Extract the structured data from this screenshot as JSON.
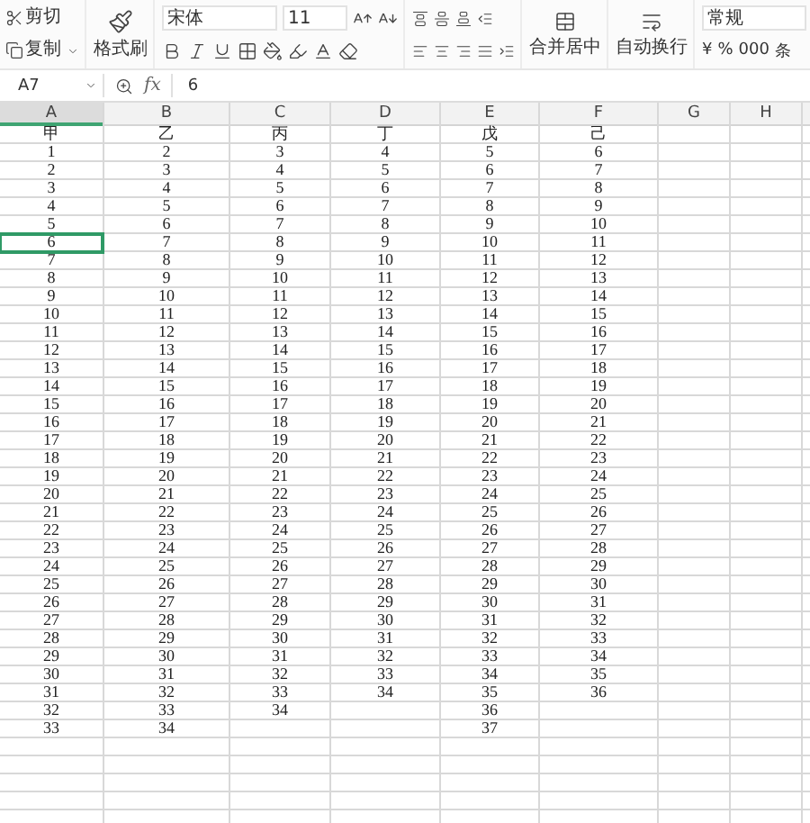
{
  "toolbar": {
    "cut": "剪切",
    "copy": "复制",
    "format_painter": "格式刷",
    "font_name": "宋体",
    "font_size": "11",
    "merge": "合并居中",
    "wrap": "自动换行",
    "number_format": "常规",
    "number_buttons": [
      "¥",
      "%",
      "000"
    ],
    "cut_off_label": "条"
  },
  "formula_bar": {
    "cell_ref": "A7",
    "fx": "fx",
    "value": "6"
  },
  "sheet": {
    "columns": [
      {
        "header": "A",
        "selected": true,
        "cells": [
          {
            "value": "甲",
            "selected": false
          },
          {
            "value": "1",
            "selected": false
          },
          {
            "value": "2",
            "selected": false
          },
          {
            "value": "3",
            "selected": false
          },
          {
            "value": "4",
            "selected": false
          },
          {
            "value": "5",
            "selected": false
          },
          {
            "value": "6",
            "selected": true
          },
          {
            "value": "7",
            "selected": false
          },
          {
            "value": "8",
            "selected": false
          },
          {
            "value": "9",
            "selected": false
          },
          {
            "value": "10",
            "selected": false
          },
          {
            "value": "11",
            "selected": false
          },
          {
            "value": "12",
            "selected": false
          },
          {
            "value": "13",
            "selected": false
          },
          {
            "value": "14",
            "selected": false
          },
          {
            "value": "15",
            "selected": false
          },
          {
            "value": "16",
            "selected": false
          },
          {
            "value": "17",
            "selected": false
          },
          {
            "value": "18",
            "selected": false
          },
          {
            "value": "19",
            "selected": false
          },
          {
            "value": "20",
            "selected": false
          },
          {
            "value": "21",
            "selected": false
          },
          {
            "value": "22",
            "selected": false
          },
          {
            "value": "23",
            "selected": false
          },
          {
            "value": "24",
            "selected": false
          },
          {
            "value": "25",
            "selected": false
          },
          {
            "value": "26",
            "selected": false
          },
          {
            "value": "27",
            "selected": false
          },
          {
            "value": "28",
            "selected": false
          },
          {
            "value": "29",
            "selected": false
          },
          {
            "value": "30",
            "selected": false
          },
          {
            "value": "31",
            "selected": false
          },
          {
            "value": "32",
            "selected": false
          },
          {
            "value": "33",
            "selected": false
          }
        ]
      },
      {
        "header": "B",
        "selected": false,
        "cells": [
          {
            "value": "乙",
            "selected": false
          },
          {
            "value": "2",
            "selected": false
          },
          {
            "value": "3",
            "selected": false
          },
          {
            "value": "4",
            "selected": false
          },
          {
            "value": "5",
            "selected": false
          },
          {
            "value": "6",
            "selected": false
          },
          {
            "value": "7",
            "selected": false
          },
          {
            "value": "8",
            "selected": false
          },
          {
            "value": "9",
            "selected": false
          },
          {
            "value": "10",
            "selected": false
          },
          {
            "value": "11",
            "selected": false
          },
          {
            "value": "12",
            "selected": false
          },
          {
            "value": "13",
            "selected": false
          },
          {
            "value": "14",
            "selected": false
          },
          {
            "value": "15",
            "selected": false
          },
          {
            "value": "16",
            "selected": false
          },
          {
            "value": "17",
            "selected": false
          },
          {
            "value": "18",
            "selected": false
          },
          {
            "value": "19",
            "selected": false
          },
          {
            "value": "20",
            "selected": false
          },
          {
            "value": "21",
            "selected": false
          },
          {
            "value": "22",
            "selected": false
          },
          {
            "value": "23",
            "selected": false
          },
          {
            "value": "24",
            "selected": false
          },
          {
            "value": "25",
            "selected": false
          },
          {
            "value": "26",
            "selected": false
          },
          {
            "value": "27",
            "selected": false
          },
          {
            "value": "28",
            "selected": false
          },
          {
            "value": "29",
            "selected": false
          },
          {
            "value": "30",
            "selected": false
          },
          {
            "value": "31",
            "selected": false
          },
          {
            "value": "32",
            "selected": false
          },
          {
            "value": "33",
            "selected": false
          },
          {
            "value": "34",
            "selected": false
          }
        ]
      },
      {
        "header": "C",
        "selected": false,
        "cells": [
          {
            "value": "丙",
            "selected": false
          },
          {
            "value": "3",
            "selected": false
          },
          {
            "value": "4",
            "selected": false
          },
          {
            "value": "5",
            "selected": false
          },
          {
            "value": "6",
            "selected": false
          },
          {
            "value": "7",
            "selected": false
          },
          {
            "value": "8",
            "selected": false
          },
          {
            "value": "9",
            "selected": false
          },
          {
            "value": "10",
            "selected": false
          },
          {
            "value": "11",
            "selected": false
          },
          {
            "value": "12",
            "selected": false
          },
          {
            "value": "13",
            "selected": false
          },
          {
            "value": "14",
            "selected": false
          },
          {
            "value": "15",
            "selected": false
          },
          {
            "value": "16",
            "selected": false
          },
          {
            "value": "17",
            "selected": false
          },
          {
            "value": "18",
            "selected": false
          },
          {
            "value": "19",
            "selected": false
          },
          {
            "value": "20",
            "selected": false
          },
          {
            "value": "21",
            "selected": false
          },
          {
            "value": "22",
            "selected": false
          },
          {
            "value": "23",
            "selected": false
          },
          {
            "value": "24",
            "selected": false
          },
          {
            "value": "25",
            "selected": false
          },
          {
            "value": "26",
            "selected": false
          },
          {
            "value": "27",
            "selected": false
          },
          {
            "value": "28",
            "selected": false
          },
          {
            "value": "29",
            "selected": false
          },
          {
            "value": "30",
            "selected": false
          },
          {
            "value": "31",
            "selected": false
          },
          {
            "value": "32",
            "selected": false
          },
          {
            "value": "33",
            "selected": false
          },
          {
            "value": "34",
            "selected": false
          }
        ]
      },
      {
        "header": "D",
        "selected": false,
        "cells": [
          {
            "value": "丁",
            "selected": false
          },
          {
            "value": "4",
            "selected": false
          },
          {
            "value": "5",
            "selected": false
          },
          {
            "value": "6",
            "selected": false
          },
          {
            "value": "7",
            "selected": false
          },
          {
            "value": "8",
            "selected": false
          },
          {
            "value": "9",
            "selected": false
          },
          {
            "value": "10",
            "selected": false
          },
          {
            "value": "11",
            "selected": false
          },
          {
            "value": "12",
            "selected": false
          },
          {
            "value": "13",
            "selected": false
          },
          {
            "value": "14",
            "selected": false
          },
          {
            "value": "15",
            "selected": false
          },
          {
            "value": "16",
            "selected": false
          },
          {
            "value": "17",
            "selected": false
          },
          {
            "value": "18",
            "selected": false
          },
          {
            "value": "19",
            "selected": false
          },
          {
            "value": "20",
            "selected": false
          },
          {
            "value": "21",
            "selected": false
          },
          {
            "value": "22",
            "selected": false
          },
          {
            "value": "23",
            "selected": false
          },
          {
            "value": "24",
            "selected": false
          },
          {
            "value": "25",
            "selected": false
          },
          {
            "value": "26",
            "selected": false
          },
          {
            "value": "27",
            "selected": false
          },
          {
            "value": "28",
            "selected": false
          },
          {
            "value": "29",
            "selected": false
          },
          {
            "value": "30",
            "selected": false
          },
          {
            "value": "31",
            "selected": false
          },
          {
            "value": "32",
            "selected": false
          },
          {
            "value": "33",
            "selected": false
          },
          {
            "value": "34",
            "selected": false
          }
        ]
      },
      {
        "header": "E",
        "selected": false,
        "cells": [
          {
            "value": "戊",
            "selected": false
          },
          {
            "value": "5",
            "selected": false
          },
          {
            "value": "6",
            "selected": false
          },
          {
            "value": "7",
            "selected": false
          },
          {
            "value": "8",
            "selected": false
          },
          {
            "value": "9",
            "selected": false
          },
          {
            "value": "10",
            "selected": false
          },
          {
            "value": "11",
            "selected": false
          },
          {
            "value": "12",
            "selected": false
          },
          {
            "value": "13",
            "selected": false
          },
          {
            "value": "14",
            "selected": false
          },
          {
            "value": "15",
            "selected": false
          },
          {
            "value": "16",
            "selected": false
          },
          {
            "value": "17",
            "selected": false
          },
          {
            "value": "18",
            "selected": false
          },
          {
            "value": "19",
            "selected": false
          },
          {
            "value": "20",
            "selected": false
          },
          {
            "value": "21",
            "selected": false
          },
          {
            "value": "22",
            "selected": false
          },
          {
            "value": "23",
            "selected": false
          },
          {
            "value": "24",
            "selected": false
          },
          {
            "value": "25",
            "selected": false
          },
          {
            "value": "26",
            "selected": false
          },
          {
            "value": "27",
            "selected": false
          },
          {
            "value": "28",
            "selected": false
          },
          {
            "value": "29",
            "selected": false
          },
          {
            "value": "30",
            "selected": false
          },
          {
            "value": "31",
            "selected": false
          },
          {
            "value": "32",
            "selected": false
          },
          {
            "value": "33",
            "selected": false
          },
          {
            "value": "34",
            "selected": false
          },
          {
            "value": "35",
            "selected": false
          },
          {
            "value": "36",
            "selected": false
          },
          {
            "value": "37",
            "selected": false
          }
        ]
      },
      {
        "header": "F",
        "selected": false,
        "cells": [
          {
            "value": "己",
            "selected": false
          },
          {
            "value": "6",
            "selected": false
          },
          {
            "value": "7",
            "selected": false
          },
          {
            "value": "8",
            "selected": false
          },
          {
            "value": "9",
            "selected": false
          },
          {
            "value": "10",
            "selected": false
          },
          {
            "value": "11",
            "selected": false
          },
          {
            "value": "12",
            "selected": false
          },
          {
            "value": "13",
            "selected": false
          },
          {
            "value": "14",
            "selected": false
          },
          {
            "value": "15",
            "selected": false
          },
          {
            "value": "16",
            "selected": false
          },
          {
            "value": "17",
            "selected": false
          },
          {
            "value": "18",
            "selected": false
          },
          {
            "value": "19",
            "selected": false
          },
          {
            "value": "20",
            "selected": false
          },
          {
            "value": "21",
            "selected": false
          },
          {
            "value": "22",
            "selected": false
          },
          {
            "value": "23",
            "selected": false
          },
          {
            "value": "24",
            "selected": false
          },
          {
            "value": "25",
            "selected": false
          },
          {
            "value": "26",
            "selected": false
          },
          {
            "value": "27",
            "selected": false
          },
          {
            "value": "28",
            "selected": false
          },
          {
            "value": "29",
            "selected": false
          },
          {
            "value": "30",
            "selected": false
          },
          {
            "value": "31",
            "selected": false
          },
          {
            "value": "32",
            "selected": false
          },
          {
            "value": "33",
            "selected": false
          },
          {
            "value": "34",
            "selected": false
          },
          {
            "value": "35",
            "selected": false
          },
          {
            "value": "36",
            "selected": false
          }
        ]
      },
      {
        "header": "G",
        "selected": false
      },
      {
        "header": "H",
        "selected": false
      }
    ]
  }
}
